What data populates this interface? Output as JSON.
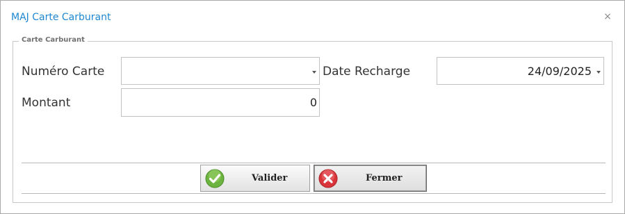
{
  "dialog": {
    "title": "MAJ Carte Carburant",
    "close_glyph": "×",
    "group_legend": "Carte Carburant"
  },
  "form": {
    "card_number": {
      "label": "Numéro Carte",
      "value": ""
    },
    "recharge_date": {
      "label": "Date Recharge",
      "value": "24/09/2025"
    },
    "amount": {
      "label": "Montant",
      "value": "0"
    }
  },
  "buttons": {
    "validate": {
      "label": "Valider",
      "icon": "check-icon",
      "color": "#6cb33f"
    },
    "close": {
      "label": "Fermer",
      "icon": "cancel-icon",
      "color": "#d9343a"
    }
  },
  "colors": {
    "title": "#1e87d2",
    "border": "#c2c2c2"
  }
}
